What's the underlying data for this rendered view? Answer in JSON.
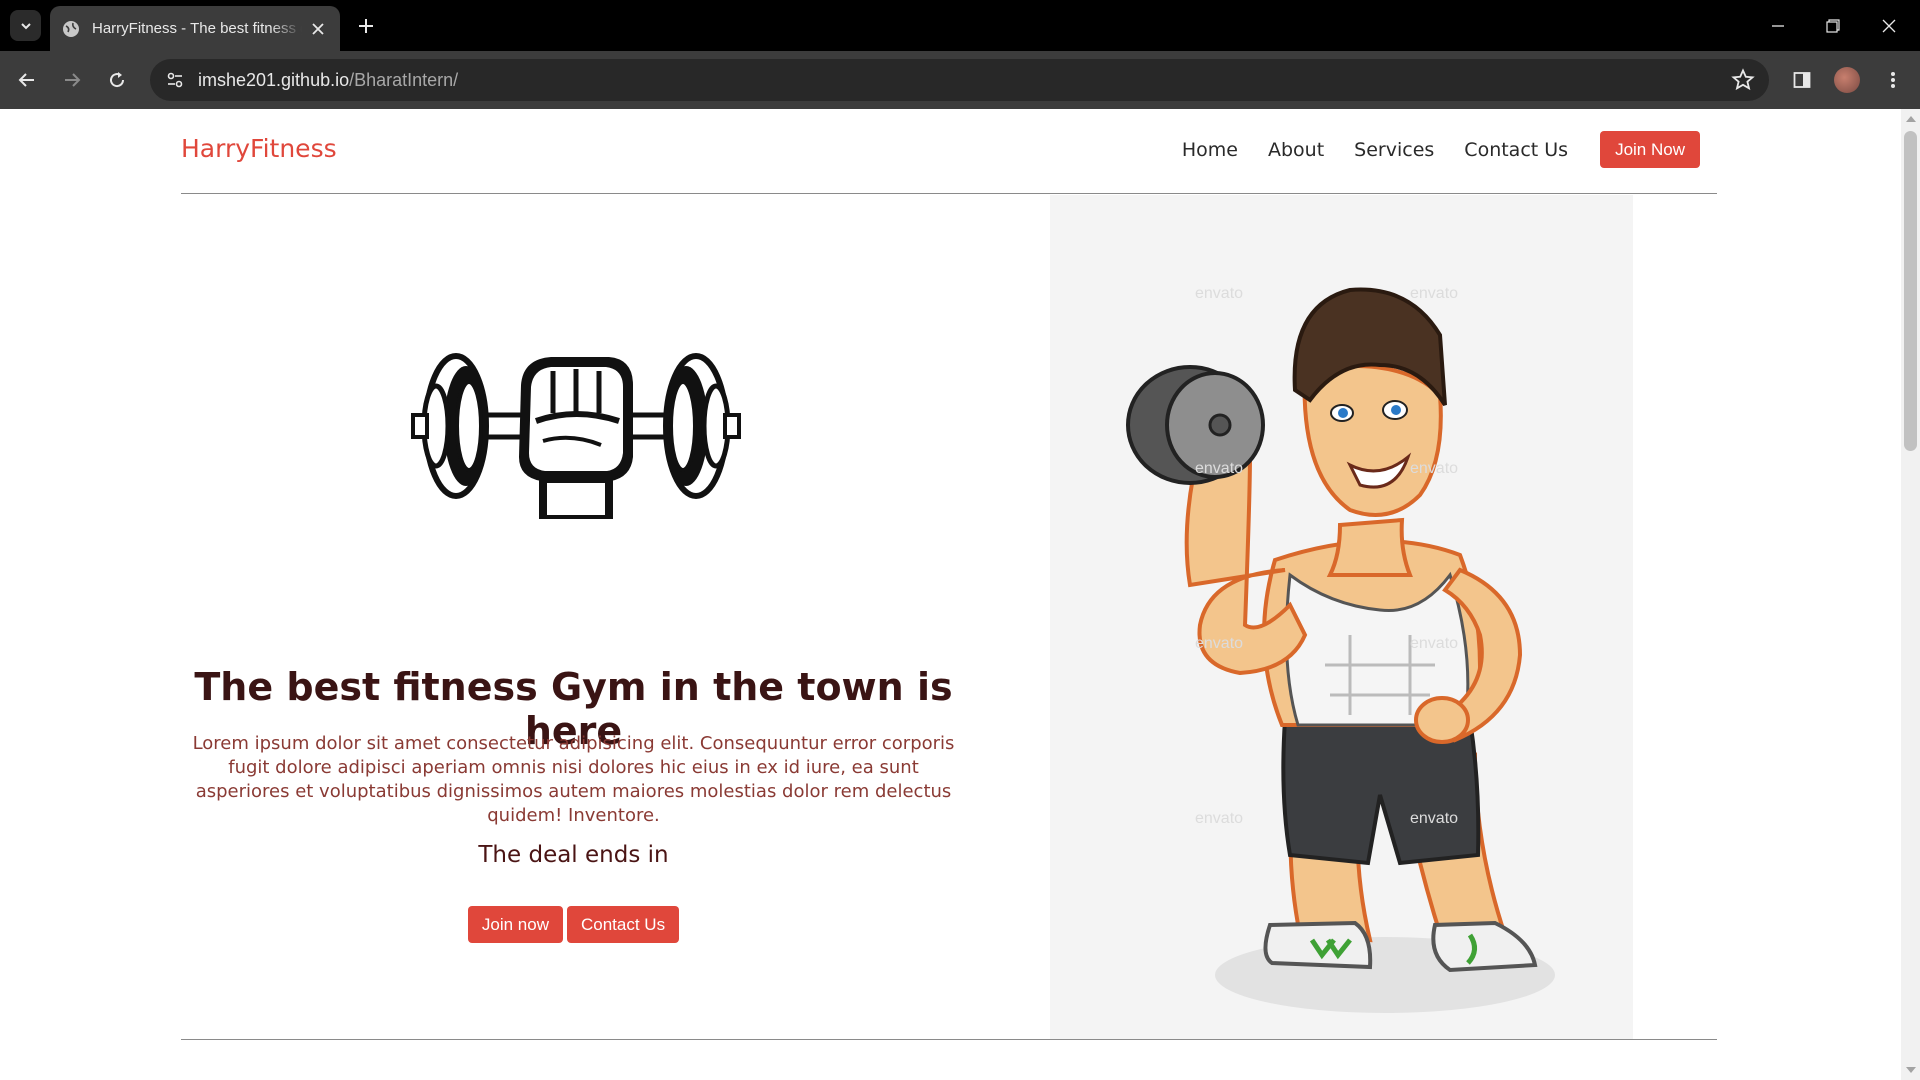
{
  "browser": {
    "tab_title": "HarryFitness - The best fitness gym",
    "url_host": "imshe201.github.io",
    "url_path": "/BharatIntern/"
  },
  "site": {
    "brand": "HarryFitness",
    "nav": [
      {
        "label": "Home"
      },
      {
        "label": "About"
      },
      {
        "label": "Services"
      },
      {
        "label": "Contact Us"
      }
    ],
    "join_button": "Join Now"
  },
  "hero": {
    "title": "The best fitness Gym in the town is here",
    "description": "Lorem ipsum dolor sit amet consectetur adipisicing elit. Consequuntur error corporis fugit dolore adipisci aperiam omnis nisi dolores hic eius in ex id iure, ea sunt asperiores et voluptatibus dignissimos autem maiores molestias dolor rem delectus quidem! Inventore.",
    "deal_text": "The deal ends in",
    "btn_join": "Join now",
    "btn_contact": "Contact Us"
  },
  "illustration": {
    "watermark": "envato"
  },
  "colors": {
    "accent": "#e0473b",
    "heading": "#3a1414",
    "body_text": "#8a3a34"
  }
}
